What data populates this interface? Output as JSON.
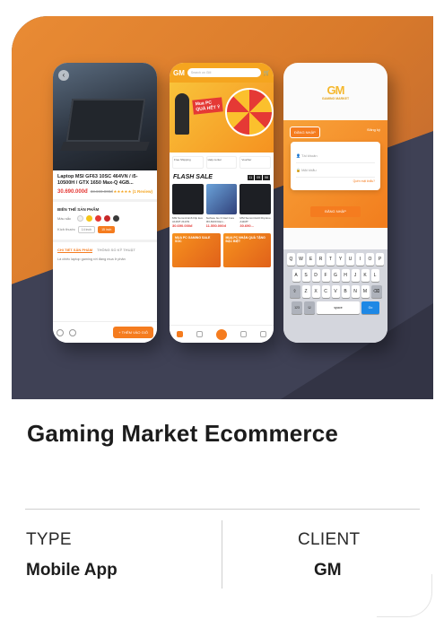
{
  "card": {
    "title": "Gaming Market Ecommerce",
    "meta": [
      {
        "label": "TYPE",
        "value": "Mobile App"
      },
      {
        "label": "CLIENT",
        "value": "GM"
      }
    ]
  },
  "mockup": {
    "product_screen": {
      "product_title": "Laptop MSI GF63 10SC 464VN / i5-10500H / GTX 1650 Max-Q 4GB...",
      "price": "30.690.000đ",
      "old_price": "33.690.000đ",
      "rating": "★★★★★ (1 Review)",
      "variants_header": "BIẾN THỂ SẢN PHẨM",
      "color_label": "Màu sắc",
      "size_label": "Kích thước",
      "size_options": [
        "14 inch",
        "15 inch"
      ],
      "tab_detail": "CHI TIẾT SẢN PHẨM",
      "tab_specs": "THÔNG SỐ KỸ THUẬT",
      "description": "Là chiếc laptop gaming rời đáng mua ở phân",
      "add_to_cart": "+ THÊM VÀO GIỎ",
      "colors": [
        "#f1f1f1",
        "#f5c518",
        "#e53935",
        "#c62828",
        "#3a3a3a"
      ]
    },
    "home_screen": {
      "logo": "GM",
      "search_placeholder": "Search on GM",
      "banner_tag": "Mua PC",
      "banner_sub": "QUÀ HẾT Ý",
      "badges": [
        "Free Shipping",
        "Help center",
        "Voucher",
        "Hàng chính hãng"
      ],
      "flash_title": "FLASH SALE",
      "timer": [
        "11",
        "09",
        "58"
      ],
      "products": [
        {
          "name": "MSI Summit E16 Flip Evo A11MT 211VN",
          "price": "30.690.000đ"
        },
        {
          "name": "Surface Go 3 Intel Core M3-8100 Ram...",
          "price": "11.550.000đ"
        },
        {
          "name": "MSI Summit E13 Flip Evo A11MT",
          "price": "30.690..."
        }
      ],
      "promos": [
        "MUA PC GAMING SALE SỐC",
        "MUA PC NHẬN QUÀ TẶNG ĐẶC BIỆT"
      ],
      "nav": [
        "Home",
        "Giỏ hàng",
        "Build PC",
        "Notification",
        "Account"
      ]
    },
    "login_screen": {
      "logo": "GM",
      "brand_name": "GAMING MARKET",
      "tab_login": "ĐĂNG NHẬP",
      "tab_register": "Đăng ký",
      "username_placeholder": "Tài khoản",
      "password_placeholder": "Mật khẩu",
      "forgot": "Quên mật khẩu?",
      "submit": "ĐĂNG NHẬP",
      "keyboard_rows": [
        [
          "Q",
          "W",
          "E",
          "R",
          "T",
          "Y",
          "U",
          "I",
          "O",
          "P"
        ],
        [
          "A",
          "S",
          "D",
          "F",
          "G",
          "H",
          "J",
          "K",
          "L"
        ],
        [
          "Z",
          "X",
          "C",
          "V",
          "B",
          "N",
          "M"
        ]
      ],
      "space": "space",
      "go": "Go",
      "numbers": "123"
    }
  },
  "colors": {
    "accent": "#f57c1f",
    "hero_orange": "#e98b34",
    "hero_dark": "#3f4155"
  }
}
